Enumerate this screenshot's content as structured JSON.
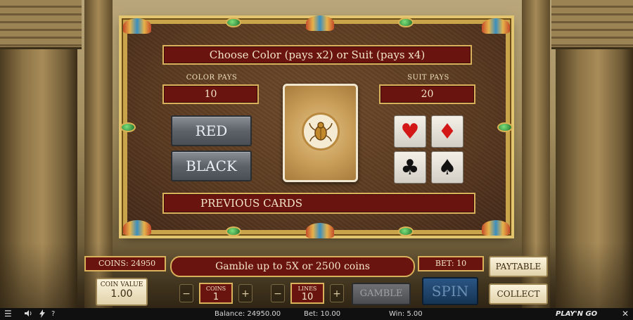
{
  "dialog": {
    "title": "Choose Color (pays x2) or Suit (pays x4)",
    "color_pays_label": "COLOR PAYS",
    "color_pays_value": "10",
    "suit_pays_label": "SUIT PAYS",
    "suit_pays_value": "20",
    "red_button": "RED",
    "black_button": "BLACK",
    "suits": [
      "♥",
      "♦",
      "♣",
      "♠"
    ],
    "previous_cards": "PREVIOUS CARDS"
  },
  "controls": {
    "coins_display": "COINS: 24950",
    "gamble_message": "Gamble up to 5X or 2500 coins",
    "bet_display": "BET: 10",
    "paytable_button": "PAYTABLE",
    "collect_button": "COLLECT",
    "coin_value_label": "COIN VALUE",
    "coin_value": "1.00",
    "coins_label": "COINS",
    "coins_value": "1",
    "lines_label": "LINES",
    "lines_value": "10",
    "minus": "−",
    "plus": "+",
    "gamble_button": "GAMBLE",
    "spin_button": "SPIN"
  },
  "statusbar": {
    "menu_icon": "☰",
    "sound_icon": "🔊",
    "turbo_icon": "⚡",
    "help_icon": "?",
    "balance": "Balance: 24950.00",
    "bet": "Bet: 10.00",
    "win": "Win: 5.00",
    "logo": "PLAY'N GO",
    "close_icon": "✕"
  },
  "colors": {
    "banner": "#6a1410",
    "gold": "#d8b15a",
    "heart_red": "#d31717"
  }
}
